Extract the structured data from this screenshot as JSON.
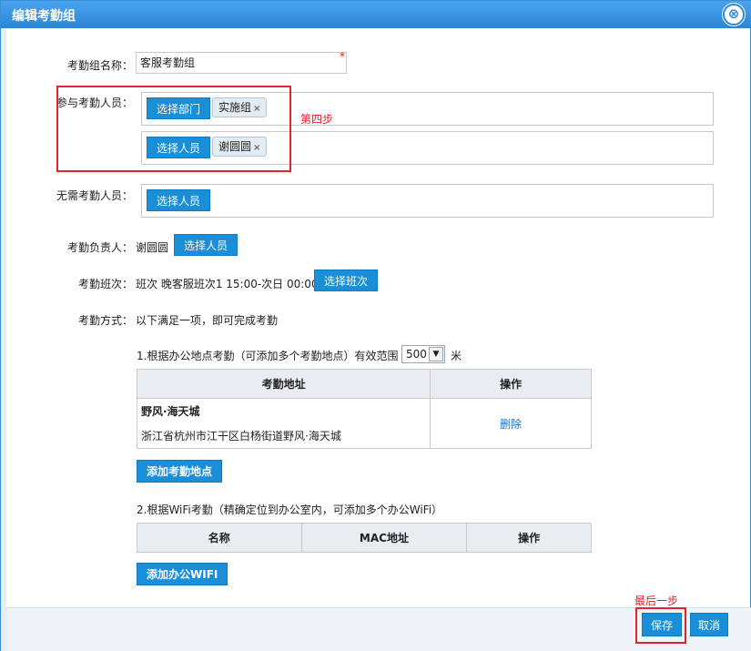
{
  "dialog": {
    "title": "编辑考勤组",
    "close_glyph": "⊗"
  },
  "group_name": {
    "label": "考勤组名称：",
    "value": "客服考勤组",
    "required_mark": "*"
  },
  "participants": {
    "label": "参与考勤人员：",
    "select_dept_label": "选择部门",
    "dept_tag": "实施组",
    "select_person_label": "选择人员",
    "person_tag": "谢圆圆",
    "remove_glyph": "×",
    "annotation": "第四步"
  },
  "exempt": {
    "label": "无需考勤人员：",
    "select_person_label": "选择人员"
  },
  "owner": {
    "label": "考勤负责人：",
    "value": "谢圆圆",
    "select_person_label": "选择人员"
  },
  "shift": {
    "label": "考勤班次：",
    "value": "班次 晚客服班次1 15:00-次日 00:00",
    "select_shift_label": "选择班次"
  },
  "method": {
    "label": "考勤方式：",
    "value": "以下满足一项，即可完成考勤"
  },
  "location_rule": {
    "heading": "1.根据办公地点考勤（可添加多个考勤地点）有效范围",
    "range_value": "500",
    "range_unit": "米",
    "arrow_glyph": "▼",
    "columns": [
      "考勤地址",
      "操作"
    ],
    "rows": [
      {
        "name": "野风·海天城",
        "address": "浙江省杭州市江干区白杨街道野风·海天城",
        "action": "删除"
      }
    ],
    "add_label": "添加考勤地点"
  },
  "wifi_rule": {
    "heading": "2.根据WiFi考勤（精确定位到办公室内，可添加多个办公WiFi）",
    "columns": [
      "名称",
      "MAC地址",
      "操作"
    ],
    "add_label": "添加办公WIFI"
  },
  "footer": {
    "annotation": "最后一步",
    "save_label": "保存",
    "cancel_label": "取消"
  },
  "colors": {
    "accent": "#1a8fd8",
    "annotation": "#e0242a",
    "titlebar": "#2b86d6"
  }
}
